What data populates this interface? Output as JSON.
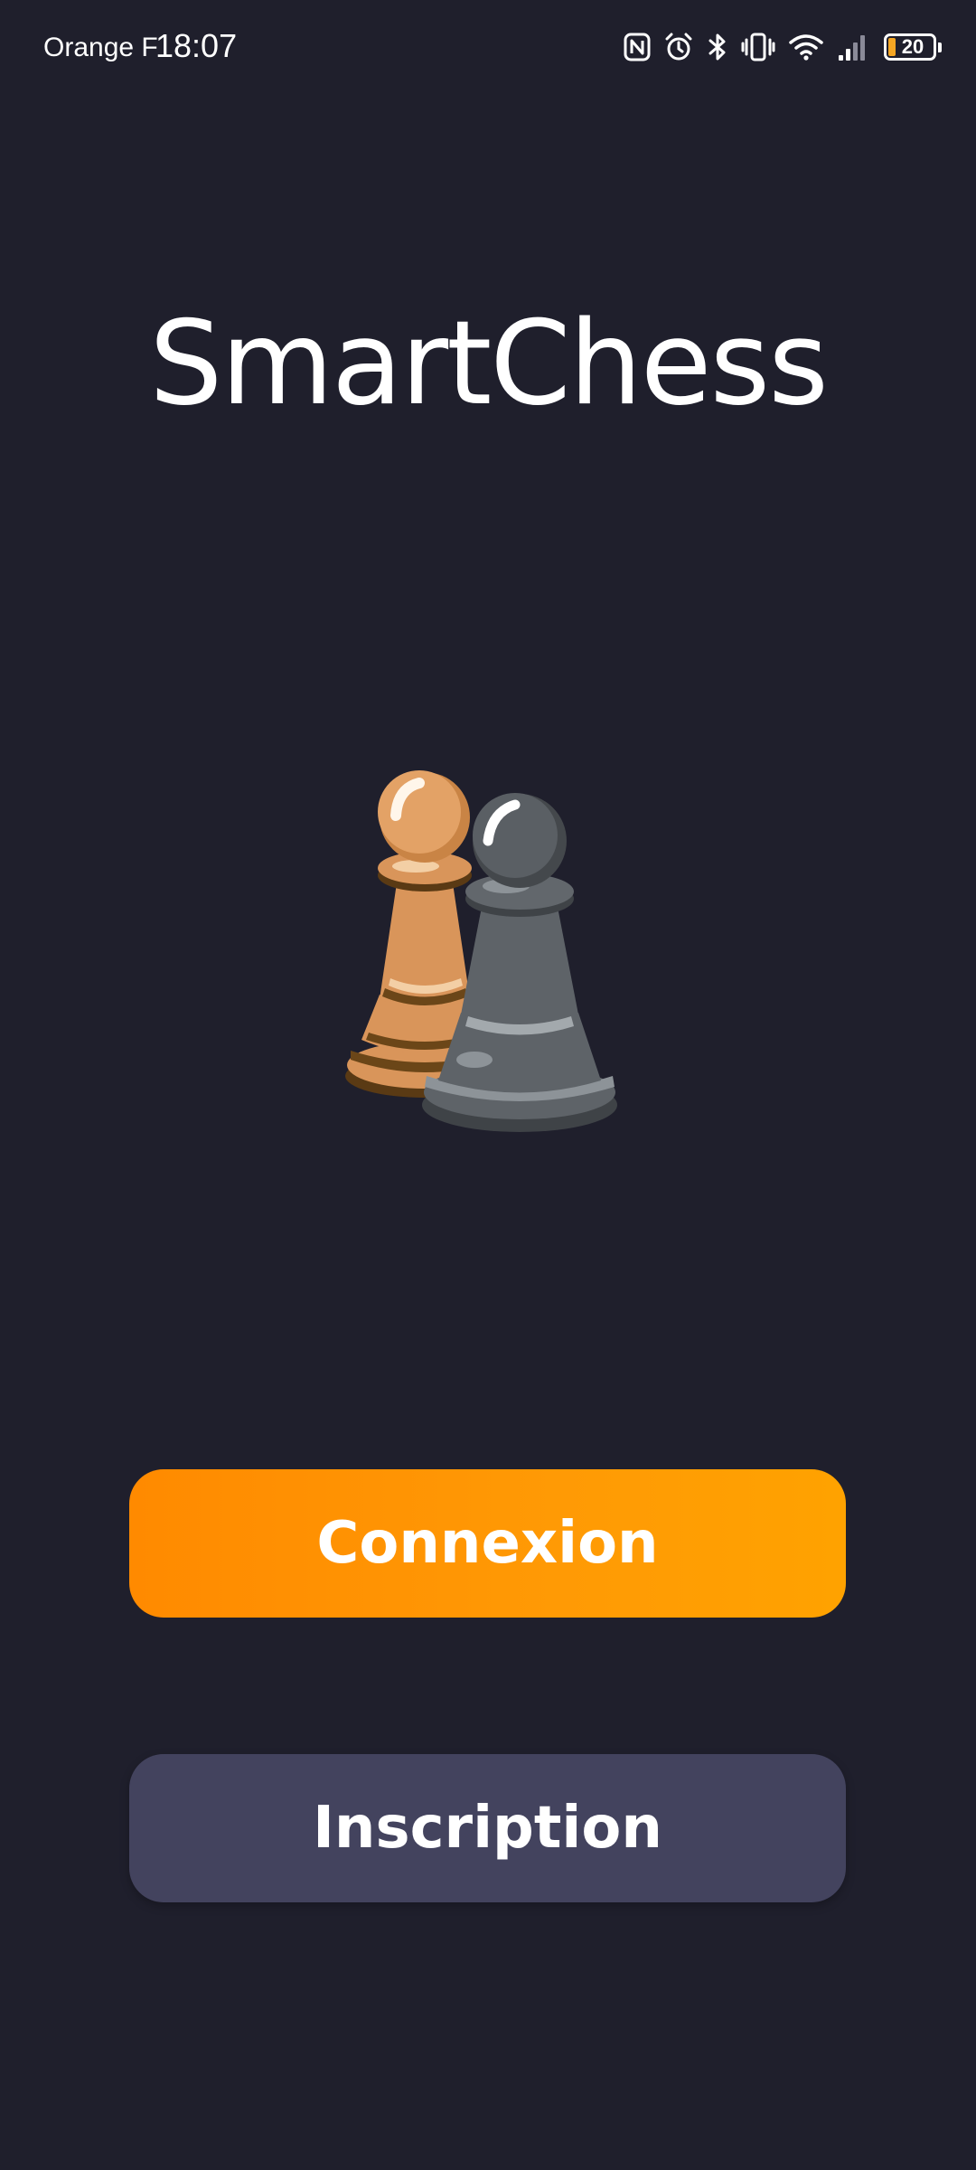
{
  "status_bar": {
    "carrier": "Orange F",
    "time": "18:07",
    "battery_level": "20",
    "icons": [
      "nfc-icon",
      "alarm-icon",
      "bluetooth-icon",
      "vibrate-icon",
      "wifi-icon",
      "signal-icon",
      "battery-icon"
    ]
  },
  "app": {
    "title": "SmartChess",
    "illustration": "chess-pawns-icon"
  },
  "actions": {
    "login_label": "Connexion",
    "signup_label": "Inscription"
  },
  "colors": {
    "background": "#1f1f2c",
    "login_button": "#ff9000",
    "signup_button": "#43435e",
    "battery_low": "#f5a623"
  }
}
